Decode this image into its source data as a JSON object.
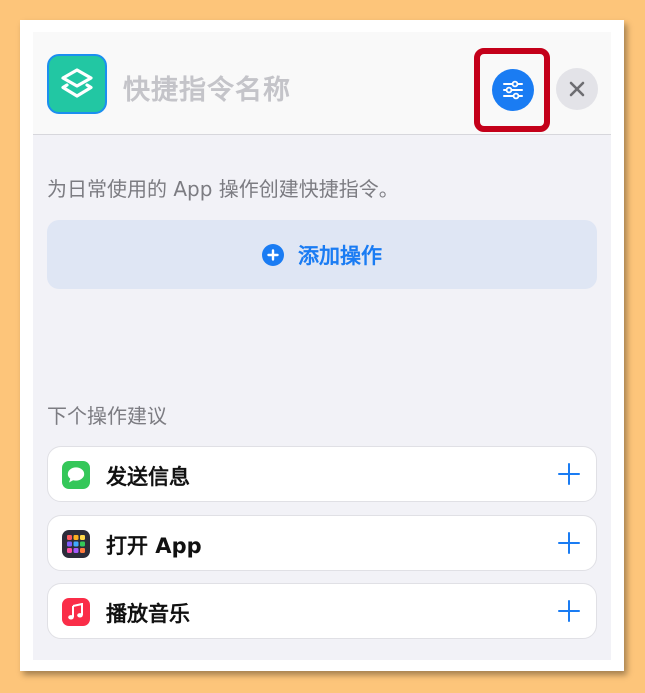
{
  "header": {
    "title": "快捷指令名称"
  },
  "description": "为日常使用的 App 操作创建快捷指令。",
  "add_action": {
    "label": "添加操作"
  },
  "suggestions": {
    "title": "下个操作建议",
    "items": [
      {
        "label": "发送信息",
        "icon": "messages-icon"
      },
      {
        "label": "打开 App",
        "icon": "app-grid-icon"
      },
      {
        "label": "播放音乐",
        "icon": "music-icon"
      }
    ]
  },
  "colors": {
    "accent": "#1a7cf3",
    "highlight": "#c4001a",
    "shortcuts_icon": "#22c7a3",
    "messages": "#34c759",
    "music": "#fa2d48",
    "backdrop": "#fdc57a"
  }
}
